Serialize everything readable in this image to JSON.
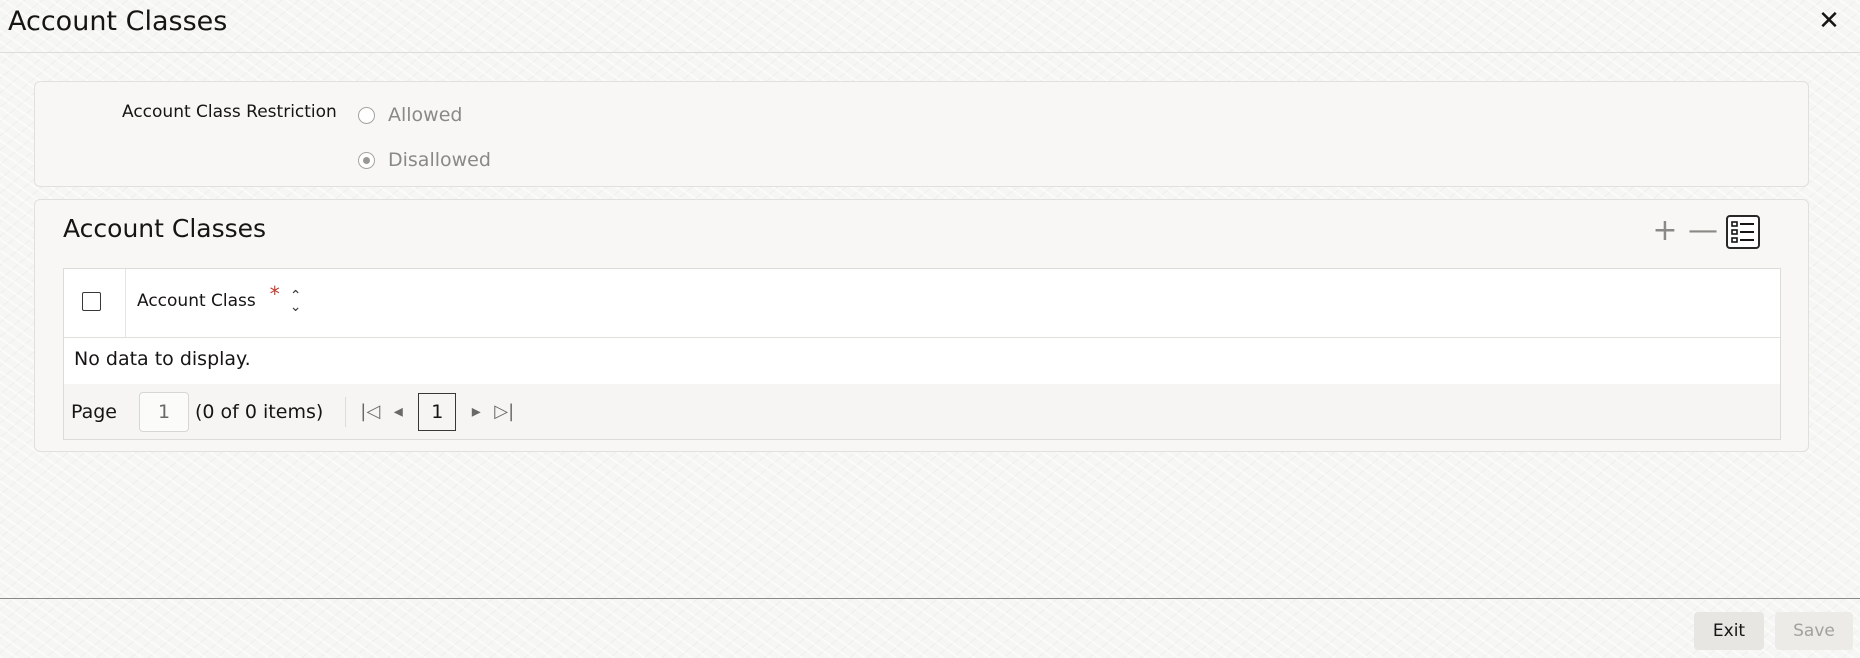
{
  "header": {
    "title": "Account Classes",
    "close_icon": "close-icon"
  },
  "restriction": {
    "label": "Account Class Restriction",
    "options": [
      {
        "label": "Allowed",
        "checked": false
      },
      {
        "label": "Disallowed",
        "checked": true
      }
    ]
  },
  "section": {
    "title": "Account Classes",
    "tools": [
      "add-icon",
      "remove-icon",
      "list-view-icon"
    ],
    "table": {
      "columns": [
        {
          "label": "Account Class",
          "required_mark": "*"
        }
      ],
      "empty_text": "No data to display."
    },
    "pager": {
      "page_label": "Page",
      "page_value": "1",
      "count_text": "(0 of 0 items)",
      "current_page": "1"
    }
  },
  "footer": {
    "exit_label": "Exit",
    "save_label": "Save"
  }
}
